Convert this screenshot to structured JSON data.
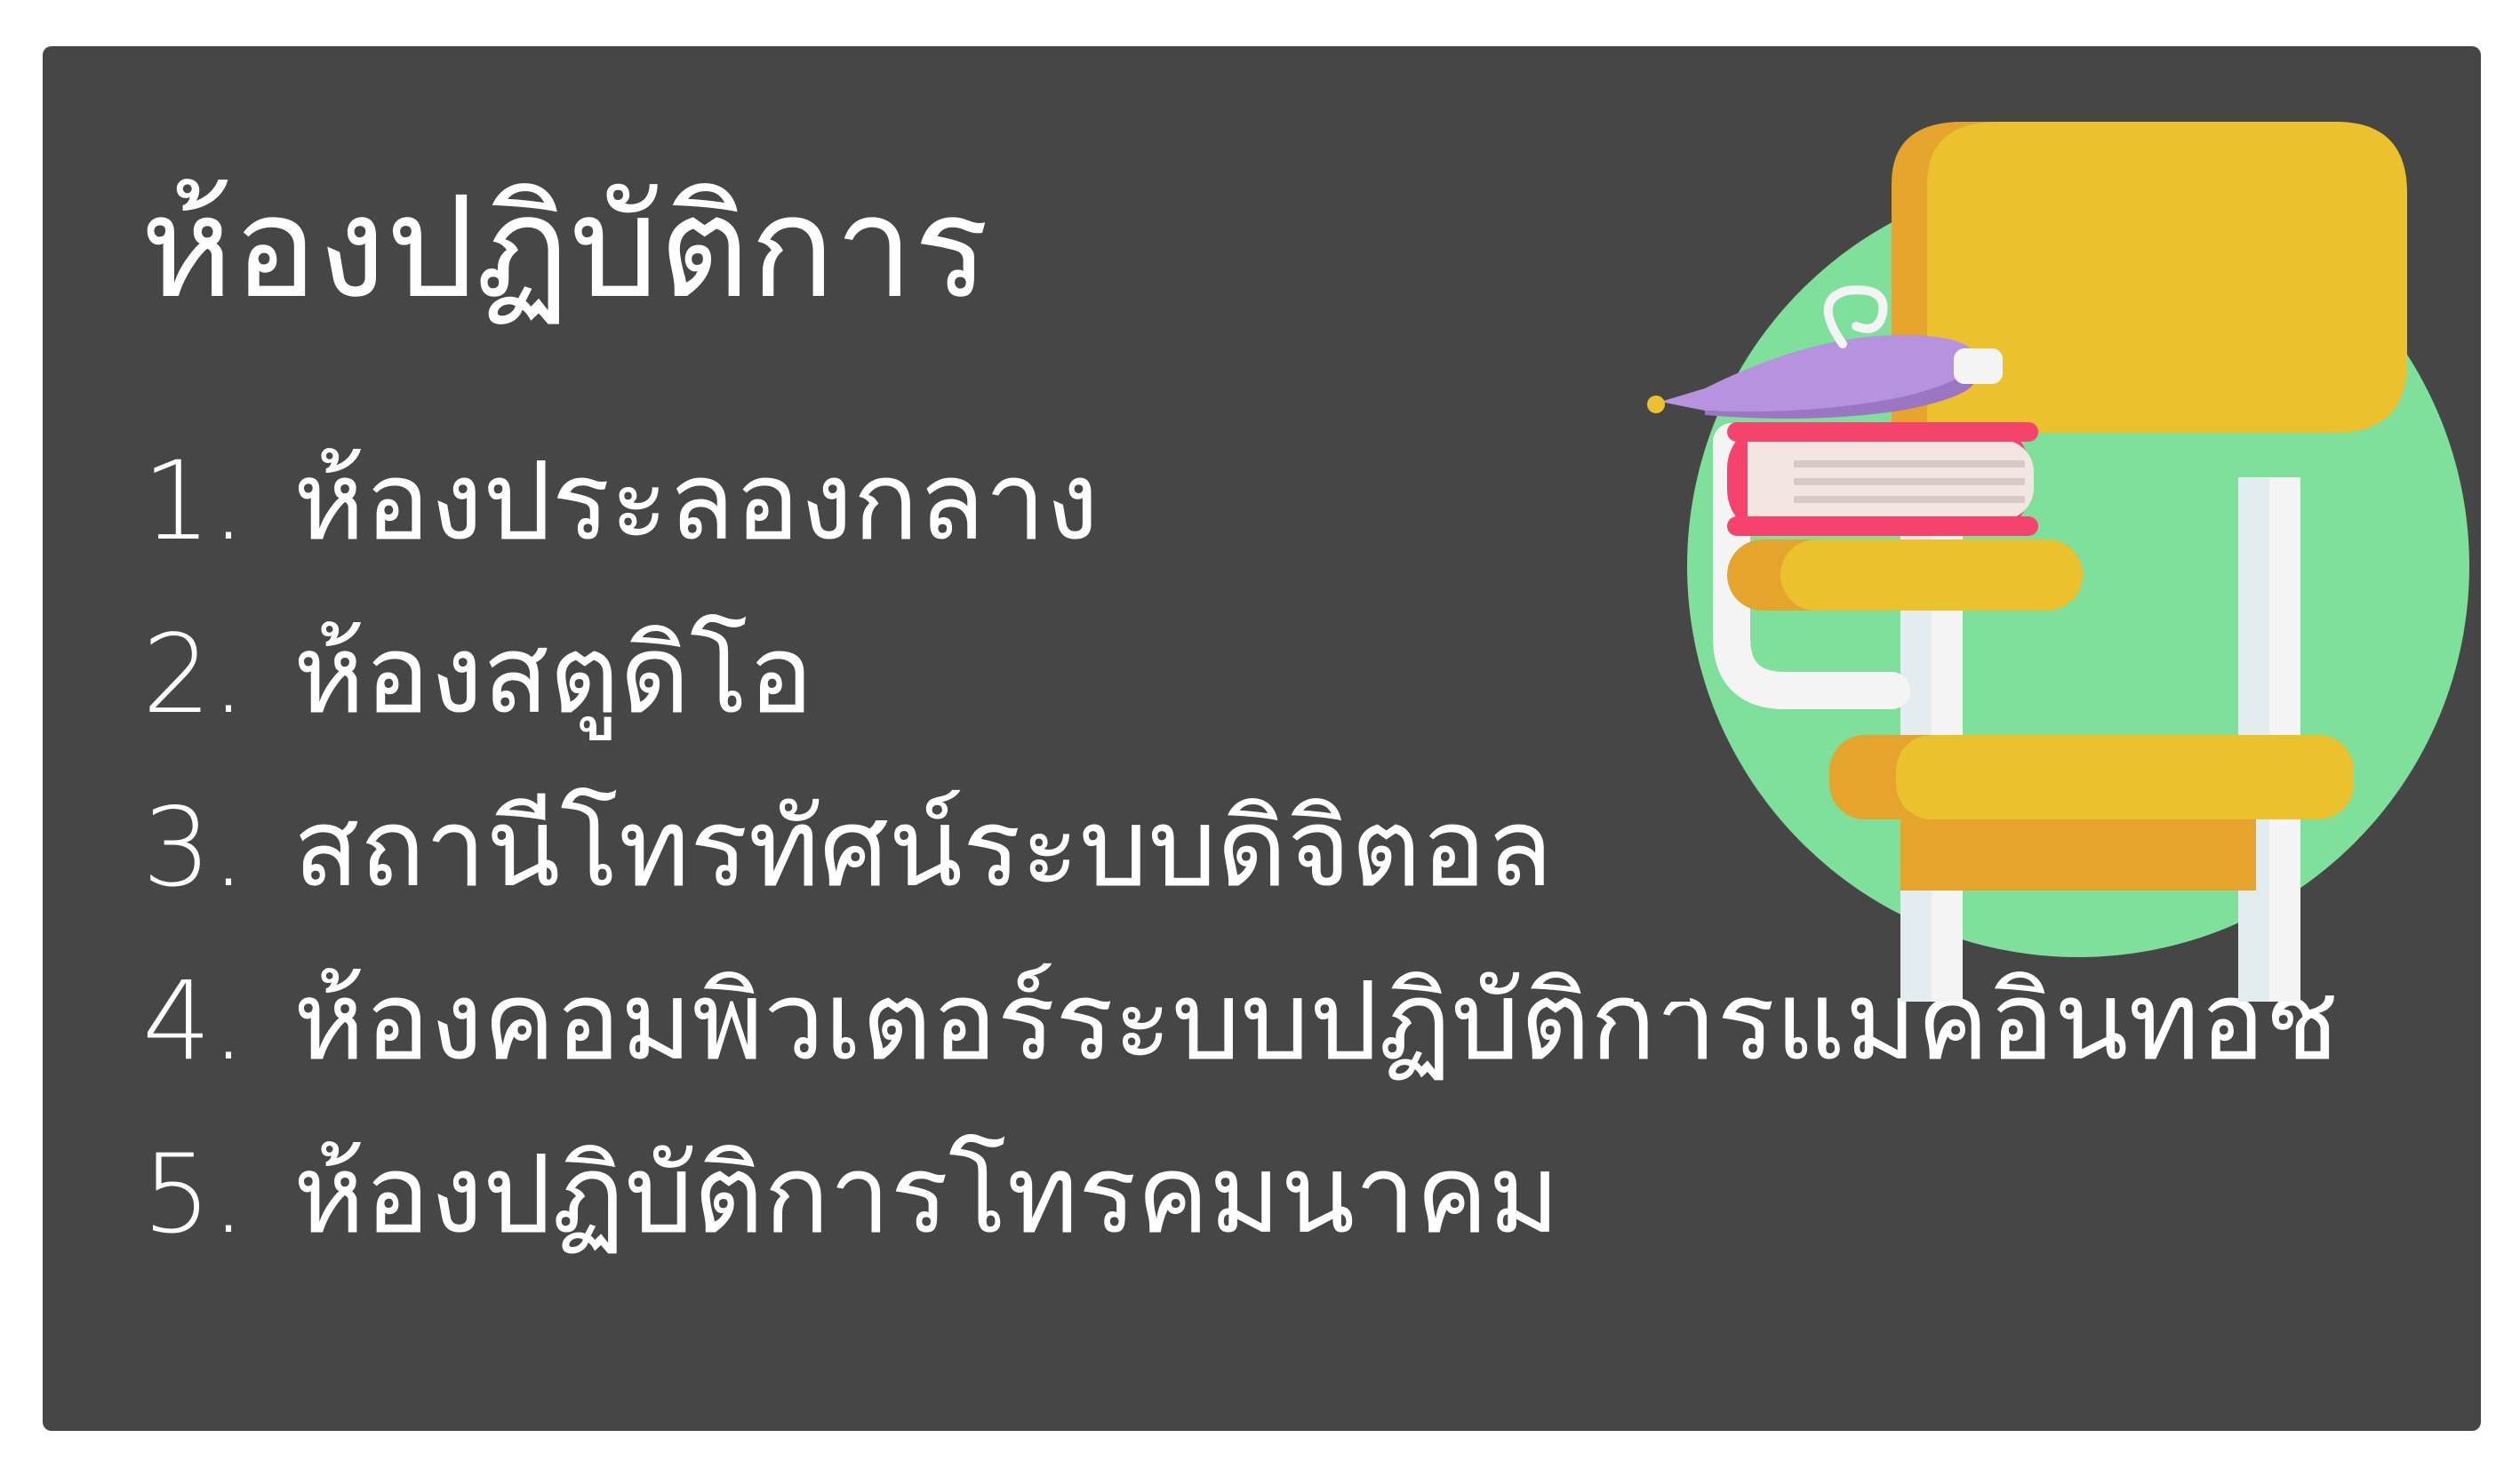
{
  "title": "ห้องปฏิบัติการ",
  "items": [
    {
      "number": "1.",
      "text": "ห้องประลองกลาง"
    },
    {
      "number": "2.",
      "text": "ห้องสตูดิโอ"
    },
    {
      "number": "3.",
      "text": "สถานีโทรทัศน์ระบบดิจิตอล"
    },
    {
      "number": "4.",
      "text": "ห้องคอมพิวเตอร์ระบบปฏิบัติการแมคอินทอช"
    },
    {
      "number": "5.",
      "text": "ห้องปฏิบัติการโทรคมนาคม"
    }
  ],
  "illustration": {
    "icon": "school-desk-chair-with-books-icon",
    "colors": {
      "background": "#464646",
      "circle": "#7EE09B",
      "chair": "#EBC12E",
      "chair_shade": "#E5A42B",
      "frame": "#F4F4F4",
      "book_cover": "#F5436E",
      "book_pages": "#F3E6E2",
      "ink_pen": "#B792DE"
    }
  }
}
